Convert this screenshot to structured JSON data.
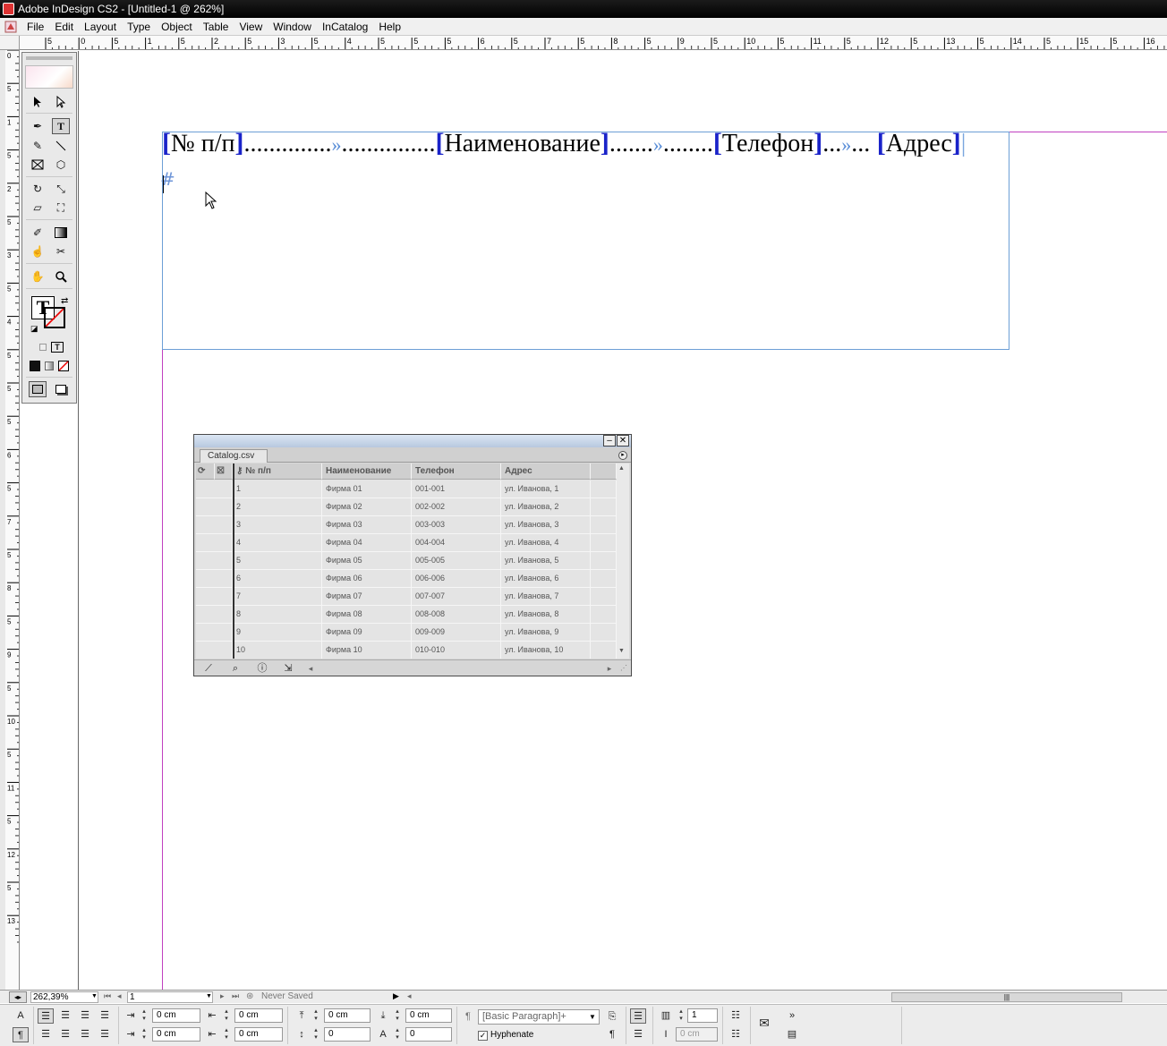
{
  "app": {
    "window_title": "Adobe InDesign CS2 - [Untitled-1 @ 262%]"
  },
  "menu": {
    "items": [
      "File",
      "Edit",
      "Layout",
      "Type",
      "Object",
      "Table",
      "View",
      "Window",
      "InCatalog",
      "Help"
    ]
  },
  "rulers": {
    "horizontal_labels": [
      "5",
      "0",
      "5",
      "1",
      "5",
      "2",
      "5",
      "3",
      "5",
      "4",
      "5",
      "5",
      "5",
      "6",
      "5",
      "7",
      "5",
      "8",
      "5",
      "9",
      "5",
      "10",
      "5",
      "11",
      "5",
      "12",
      "5",
      "13",
      "5",
      "14",
      "5",
      "15",
      "5",
      "16"
    ],
    "vertical_labels": [
      "0",
      "5",
      "1",
      "5",
      "2",
      "5",
      "3",
      "5",
      "4",
      "5",
      "5",
      "5",
      "6",
      "5",
      "7",
      "5",
      "8",
      "5",
      "9",
      "5",
      "10",
      "5",
      "11",
      "5",
      "12",
      "5",
      "13"
    ]
  },
  "document": {
    "fields": [
      {
        "text": "№ п/п",
        "leader": "..............",
        "leader2": "..............."
      },
      {
        "text": "Наименование",
        "leader": ".......",
        "leader2": "........"
      },
      {
        "text": "Телефон",
        "leader": "...",
        "leader2": "..."
      },
      {
        "text": "Адрес"
      }
    ],
    "tab_glyph": "»",
    "paragraph_end_glyph": "#"
  },
  "tools": {
    "icons": [
      "selection-icon",
      "direct-selection-icon",
      "pen-icon",
      "type-icon",
      "pencil-icon",
      "line-icon",
      "rectangle-frame-icon",
      "polygon-icon",
      "rotate-icon",
      "scale-icon",
      "shear-icon",
      "free-transform-icon",
      "eyedropper-icon",
      "gradient-icon",
      "button-icon",
      "scissors-icon",
      "hand-icon",
      "zoom-icon"
    ],
    "fill_label": "T"
  },
  "catalog": {
    "tab_label": "Catalog.csv",
    "columns": [
      "№ п/п",
      "Наименование",
      "Телефон",
      "Адрес"
    ],
    "rows": [
      [
        "1",
        "Фирма 01",
        "001-001",
        "ул. Иванова, 1"
      ],
      [
        "2",
        "Фирма 02",
        "002-002",
        "ул. Иванова, 2"
      ],
      [
        "3",
        "Фирма 03",
        "003-003",
        "ул. Иванова, 3"
      ],
      [
        "4",
        "Фирма 04",
        "004-004",
        "ул. Иванова, 4"
      ],
      [
        "5",
        "Фирма 05",
        "005-005",
        "ул. Иванова, 5"
      ],
      [
        "6",
        "Фирма 06",
        "006-006",
        "ул. Иванова, 6"
      ],
      [
        "7",
        "Фирма 07",
        "007-007",
        "ул. Иванова, 7"
      ],
      [
        "8",
        "Фирма 08",
        "008-008",
        "ул. Иванова, 8"
      ],
      [
        "9",
        "Фирма 09",
        "009-009",
        "ул. Иванова, 9"
      ],
      [
        "10",
        "Фирма 10",
        "010-010",
        "ул. Иванова, 10"
      ]
    ]
  },
  "status": {
    "zoom": "262,39%",
    "page": "1",
    "save_state": "Never Saved"
  },
  "control": {
    "left_indent": "0 cm",
    "first_line_indent": "0 cm",
    "right_indent": "0 cm",
    "last_line_indent": "0 cm",
    "space_before": "0 cm",
    "space_after": "0 cm",
    "drop_cap_lines": "0",
    "drop_cap_chars": "0",
    "paragraph_style": "[Basic Paragraph]+",
    "hyphenate_label": "Hyphenate",
    "columns": "1",
    "column_gutter": "0 cm",
    "more_glyph": "»"
  },
  "colors": {
    "tag_bracket": "#1a23c9",
    "frame_edge": "#6d9fd6",
    "margin_guide": "#c040c0"
  }
}
